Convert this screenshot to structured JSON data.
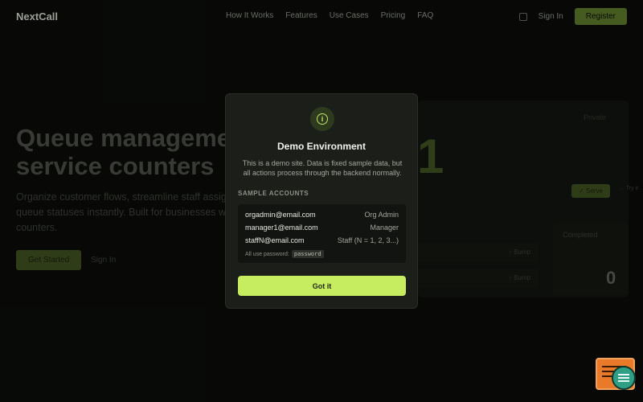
{
  "nav": {
    "logo": "NextCall",
    "links": [
      "How It Works",
      "Features",
      "Use Cases",
      "Pricing",
      "FAQ"
    ],
    "sign_in": "Sign In",
    "register": "Register",
    "theme_icon": "theme-toggle-icon"
  },
  "hero": {
    "title_lines": [
      "Queue management",
      "service counters"
    ],
    "desc_lines": [
      "Organize customer flows, streamline staff assign",
      "queue statuses instantly. Built for businesses wit",
      "counters."
    ],
    "get_started": "Get Started",
    "sign_in": "Sign In"
  },
  "preview": {
    "big_number": "1",
    "tag": "Private",
    "serve": "✓ Serve",
    "try": "← Try it",
    "completed_label": "Completed",
    "completed_count": "0",
    "bump_1": "↑ Bump",
    "bump_2": "↑ Bump"
  },
  "modal": {
    "icon": "info-icon",
    "title": "Demo Environment",
    "desc_lines": [
      "This is a demo site. Data is fixed sample data, but",
      "all actions process through the backend normally."
    ],
    "section_label": "SAMPLE ACCOUNTS",
    "accounts": [
      {
        "email": "orgadmin@email.com",
        "role": "Org Admin"
      },
      {
        "email": "manager1@email.com",
        "role": "Manager"
      },
      {
        "email": "staffN@email.com",
        "role": "Staff (N = 1, 2, 3...)"
      }
    ],
    "password_note": "All use password:",
    "password": "password",
    "button": "Got it"
  },
  "widget": {
    "icon": "feedback-widget-icon",
    "chat_icon": "chat-icon"
  },
  "colors": {
    "accent": "#c6ec5f",
    "background": "#0b0d0a",
    "modal": "#1c1e1a"
  }
}
